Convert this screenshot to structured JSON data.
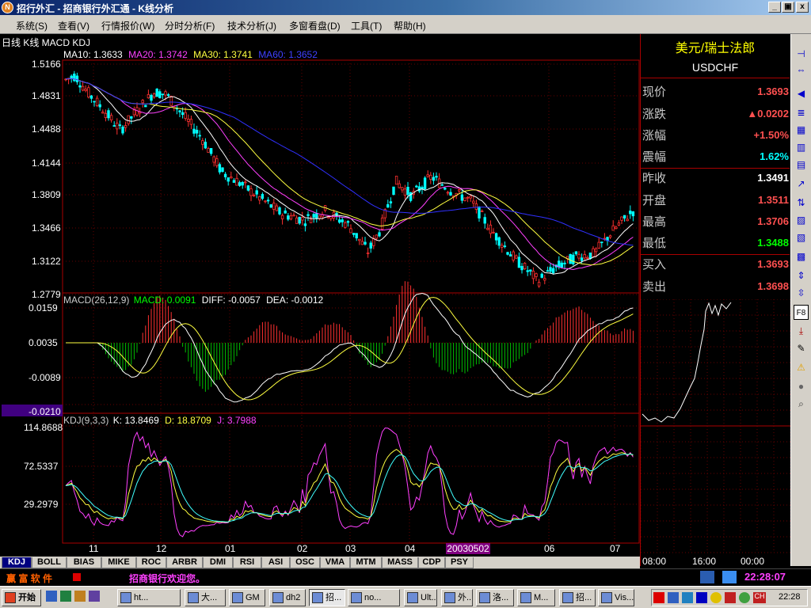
{
  "window": {
    "title": "招行外汇 - 招商银行外汇通 - K线分析",
    "logo": "N",
    "min": "_",
    "max": "▣",
    "close": "x"
  },
  "menu": [
    "系统(S)",
    "查看(V)",
    "行情报价(W)",
    "分时分析(F)",
    "技术分析(J)",
    "多窗看盘(D)",
    "工具(T)",
    "帮助(H)"
  ],
  "chart_header": "日线 K线 MACD KDJ",
  "ma_line": {
    "ma10": "MA10: 1.3633",
    "ma20": "MA20: 1.3742",
    "ma30": "MA30: 1.3741",
    "ma60": "MA60: 1.3652"
  },
  "macd_line": {
    "name": "MACD(26,12,9)",
    "macd": "MACD: 0.0091",
    "diff": "DIFF: -0.0057",
    "dea": "DEA: -0.0012"
  },
  "kdj_line": {
    "name": "KDJ(9,3,3)",
    "k": "K: 13.8469",
    "d": "D: 18.8709",
    "j": "J: 3.7988"
  },
  "price_axis": [
    "1.5166",
    "1.4831",
    "1.4488",
    "1.4144",
    "1.3809",
    "1.3466",
    "1.3122",
    "1.2779"
  ],
  "macd_axis": [
    "0.0159",
    "0.0035",
    "-0.0089",
    "-0.0210"
  ],
  "kdj_axis": [
    "114.8688",
    "72.5337",
    "29.2979"
  ],
  "x_axis": [
    "11",
    "12",
    "01",
    "02",
    "03",
    "04",
    "06",
    "07"
  ],
  "date_badge": "20030502",
  "quote": {
    "name": "美元/瑞士法郎",
    "code": "USDCHF",
    "rows": [
      {
        "label": "现价",
        "value": "1.3693",
        "color": "#ff5050"
      },
      {
        "label": "涨跌",
        "value": "▲0.0202",
        "color": "#ff5050"
      },
      {
        "label": "涨幅",
        "value": "+1.50%",
        "color": "#ff5050"
      },
      {
        "label": "震幅",
        "value": "1.62%",
        "color": "#00ffff"
      },
      {
        "label": "昨收",
        "value": "1.3491",
        "color": "#ffffff"
      },
      {
        "label": "开盘",
        "value": "1.3511",
        "color": "#ff5050"
      },
      {
        "label": "最高",
        "value": "1.3706",
        "color": "#ff5050"
      },
      {
        "label": "最低",
        "value": "1.3488",
        "color": "#00ff00"
      },
      {
        "label": "买入",
        "value": "1.3693",
        "color": "#ff5050"
      },
      {
        "label": "卖出",
        "value": "1.3698",
        "color": "#ff5050"
      }
    ],
    "time_axis": [
      "08:00",
      "16:00",
      "00:00"
    ]
  },
  "tabs": [
    "KDJ",
    "BOLL",
    "BIAS",
    "MIKE",
    "ROC",
    "ARBR",
    "DMI",
    "RSI",
    "ASI",
    "OSC",
    "VMA",
    "MTM",
    "MASS",
    "CDP",
    "PSY"
  ],
  "status": {
    "logo_text": "赢 富 软 件",
    "welcome": "招商银行欢迎您。",
    "clock": "22:28:07"
  },
  "taskbar": {
    "start": "开始",
    "items": [
      "ht...",
      "大...",
      "GM",
      "dh2",
      "招...",
      "no...",
      "Ult...",
      "外...",
      "洛...",
      "M...",
      "招...",
      "Vis..."
    ],
    "clock": "22:28"
  },
  "tool_icons": [
    "F8"
  ]
}
